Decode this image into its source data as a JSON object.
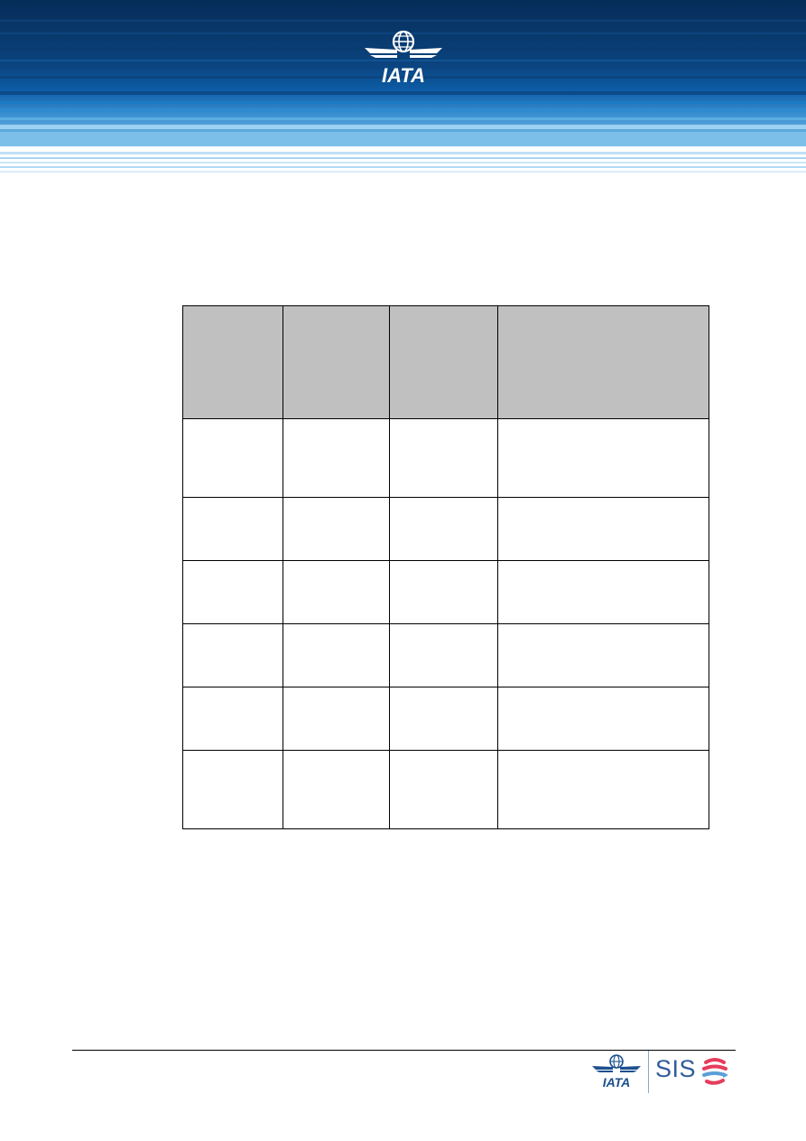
{
  "header": {
    "logo_text": "IATA",
    "colors": {
      "dark": "#003063",
      "mid": "#0e5a9e",
      "light": "#7dc0ea"
    }
  },
  "table": {
    "columns": [
      "",
      "",
      "",
      ""
    ],
    "rows": [
      [
        "",
        "",
        "",
        ""
      ],
      [
        "",
        "",
        "",
        ""
      ],
      [
        "",
        "",
        "",
        ""
      ],
      [
        "",
        "",
        "",
        ""
      ],
      [
        "",
        "",
        "",
        ""
      ],
      [
        "",
        "",
        "",
        ""
      ]
    ],
    "header_bg": "#c0c0c0"
  },
  "footer": {
    "logo_text": "IATA",
    "brand_text": "SIS",
    "brand_color": "#2f5d9b",
    "swirl_colors": [
      "#e63c5c",
      "#5aa0d8"
    ]
  }
}
